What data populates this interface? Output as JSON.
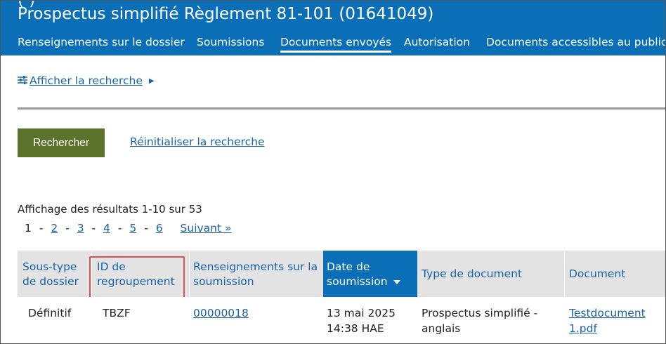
{
  "header": {
    "title": "Prospectus simplifié Règlement 81-101 (01641049)",
    "clipped_text": "(                   )"
  },
  "nav": {
    "tabs": [
      {
        "label": "Renseignements sur le dossier",
        "active": false
      },
      {
        "label": "Soumissions",
        "active": false
      },
      {
        "label": "Documents envoyés",
        "active": true
      },
      {
        "label": "Autorisation",
        "active": false
      },
      {
        "label": "Documents accessibles au public",
        "active": false
      }
    ]
  },
  "search": {
    "toggle_label": "Afficher la recherche",
    "submit_label": "Rechercher",
    "reset_label": "Réinitialiser la recherche"
  },
  "results": {
    "summary": "Affichage des résultats 1-10 sur 53",
    "pager": {
      "current": "1",
      "pages": [
        "2",
        "3",
        "4",
        "5",
        "6"
      ],
      "next_label": "Suivant »"
    }
  },
  "table": {
    "headers": {
      "subtype_line1": "Sous-type",
      "subtype_line2": "de dossier",
      "group_line1": "ID de",
      "group_line2": "regroupement",
      "info_line1": "Renseignements sur la",
      "info_line2": "soumission",
      "date_line1": "Date de",
      "date_line2": "soumission",
      "doctype": "Type de document",
      "document": "Document"
    },
    "rows": [
      {
        "subtype": "Définitif",
        "group_id": "TBZF",
        "submission": "00000018",
        "date_line1": "13 mai 2025",
        "date_line2": "14:38 HAE",
        "doctype_line1": "Prospectus simplifié -",
        "doctype_line2": "anglais",
        "document_line1": "Testdocument",
        "document_line2": "1.pdf"
      }
    ]
  },
  "colors": {
    "brand_blue": "#0b6fb8",
    "link_blue": "#1a64a8",
    "button_green": "#5a7229",
    "highlight_red": "#d9534f",
    "header_gray": "#e3e3e3"
  }
}
